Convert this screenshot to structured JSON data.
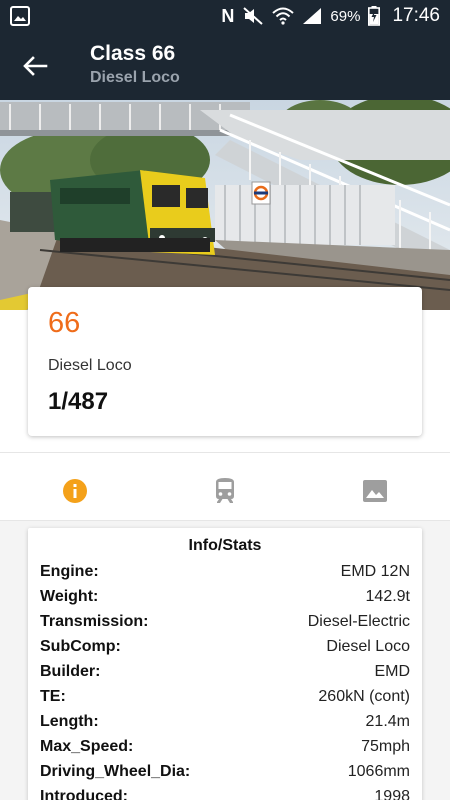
{
  "status_bar": {
    "battery": "69%",
    "time": "17:46"
  },
  "header": {
    "title": "Class 66",
    "subtitle": "Diesel Loco"
  },
  "summary": {
    "class_number": "66",
    "type": "Diesel Loco",
    "count": "1/487"
  },
  "tabs": [
    {
      "icon": "info-icon",
      "active": true
    },
    {
      "icon": "train-icon",
      "active": false
    },
    {
      "icon": "image-icon",
      "active": false
    }
  ],
  "stats": {
    "title": "Info/Stats",
    "rows": [
      {
        "key": "Engine:",
        "value": "EMD 12N"
      },
      {
        "key": "Weight:",
        "value": "142.9t"
      },
      {
        "key": "Transmission:",
        "value": "Diesel-Electric"
      },
      {
        "key": "SubComp:",
        "value": "Diesel Loco"
      },
      {
        "key": "Builder:",
        "value": "EMD"
      },
      {
        "key": "TE:",
        "value": "260kN (cont)"
      },
      {
        "key": "Length:",
        "value": "21.4m"
      },
      {
        "key": "Max_Speed:",
        "value": "75mph"
      },
      {
        "key": "Driving_Wheel_Dia:",
        "value": "1066mm"
      },
      {
        "key": "Introduced:",
        "value": "1998"
      }
    ]
  },
  "colors": {
    "app_bar": "#1c2732",
    "accent": "#ef6c1a",
    "active_tab": "#f4a11a",
    "inactive_tab": "#9e9e9e"
  }
}
